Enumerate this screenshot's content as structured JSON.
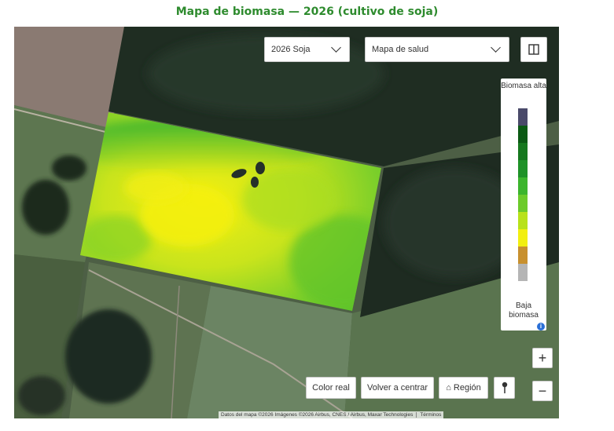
{
  "page_title": "Mapa de biomasa — 2026 (cultivo de soja)",
  "toolbar": {
    "season_select": {
      "value": "2026 Soja",
      "icon": "chevron-down-icon"
    },
    "layer_select": {
      "value": "Mapa de salud",
      "icon": "chevron-down-icon"
    },
    "split_view_icon": "split-view-icon"
  },
  "legend": {
    "high_label": "Biomasa alta",
    "low_label": "Baja biomasa",
    "info_icon": "info-icon",
    "info_glyph": "i",
    "colors": [
      "#4a4a6a",
      "#0b5a14",
      "#16781e",
      "#1f9228",
      "#3cb52d",
      "#6ccb2a",
      "#b8e21a",
      "#f2ef10",
      "#c8902e",
      "#b5b5b5"
    ]
  },
  "zoom": {
    "in_label": "+",
    "out_label": "−"
  },
  "bottom_bar": {
    "true_color": "Color real",
    "recenter": "Volver a centrar",
    "region_icon": "home-icon",
    "region": "⌂ Región",
    "pin_icon": "pin-icon"
  },
  "attribution": {
    "text": "Datos del mapa ©2026 Imágenes ©2026 Airbus, CNES / Airbus, Maxar Technologies",
    "terms": "Términos"
  }
}
